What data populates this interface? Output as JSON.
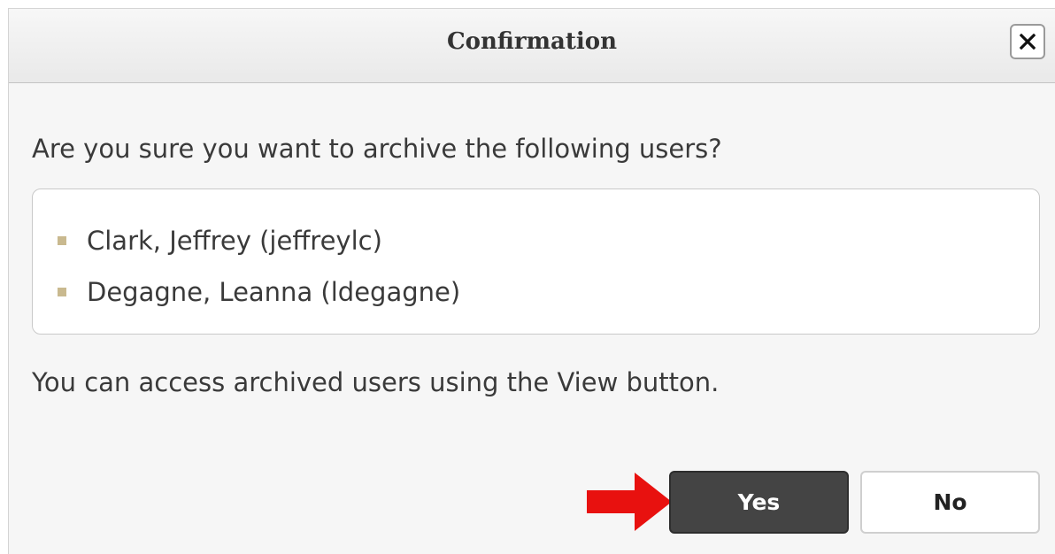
{
  "dialog": {
    "title": "Confirmation",
    "close_icon": "close-icon",
    "question": "Are you sure you want to archive the following users?",
    "users": [
      "Clark, Jeffrey (jeffreylc)",
      "Degagne, Leanna (ldegagne)"
    ],
    "info": "You can access archived users using the View button.",
    "buttons": {
      "yes_label": "Yes",
      "no_label": "No"
    }
  },
  "annotation": {
    "arrow_icon": "red-arrow-icon",
    "arrow_color": "#e8110f"
  },
  "colors": {
    "yes_button_bg": "#444444",
    "bullet": "#c9b98f",
    "dialog_bg": "#f6f6f6"
  }
}
